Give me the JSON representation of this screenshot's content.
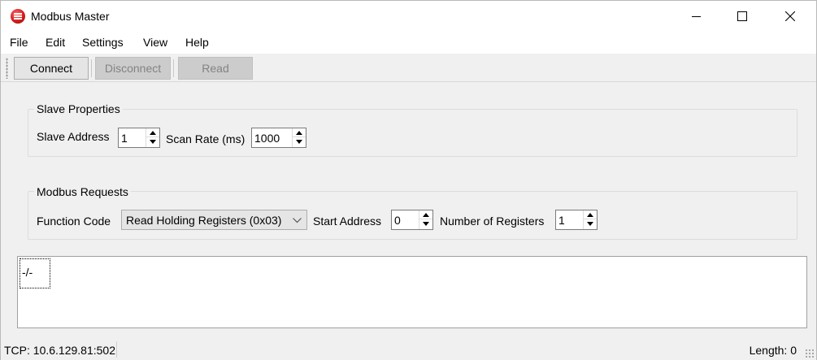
{
  "window": {
    "title": "Modbus Master",
    "app_icon": "modbus-app-icon"
  },
  "menu": [
    "File",
    "Edit",
    "Settings",
    "View",
    "Help"
  ],
  "toolbar": {
    "connect_label": "Connect",
    "disconnect_label": "Disconnect",
    "read_label": "Read"
  },
  "slave_properties": {
    "title": "Slave Properties",
    "slave_address_label": "Slave Address",
    "slave_address_value": "1",
    "scan_rate_label": "Scan Rate (ms)",
    "scan_rate_value": "1000"
  },
  "modbus_requests": {
    "title": "Modbus Requests",
    "function_code_label": "Function Code",
    "function_code_value": "Read Holding Registers (0x03)",
    "start_address_label": "Start Address",
    "start_address_value": "0",
    "num_registers_label": "Number of Registers",
    "num_registers_value": "1"
  },
  "output": {
    "cell_text": "-/-"
  },
  "status": {
    "connection": "TCP: 10.6.129.81:502",
    "length": "Length: 0"
  },
  "colors": {
    "app_icon_red": "#d31d1d",
    "disabled_text": "#838383"
  }
}
